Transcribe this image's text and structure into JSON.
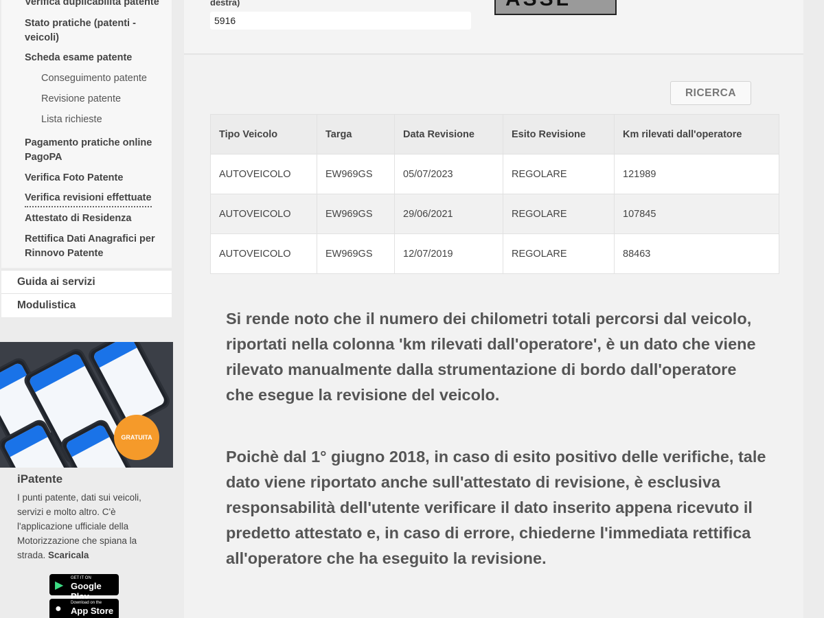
{
  "sidebar": {
    "menu_items": [
      {
        "label": "Verifica duplicabilità  patente"
      },
      {
        "label": "Stato pratiche (patenti - veicoli)"
      },
      {
        "label": "Scheda esame patente"
      },
      {
        "label": "Pagamento pratiche online PagoPA"
      },
      {
        "label": "Verifica Foto Patente"
      },
      {
        "label": "Verifica revisioni effettuate"
      },
      {
        "label": "Attestato di Residenza"
      },
      {
        "label": "Rettifica Dati Anagrafici per Rinnovo Patente"
      }
    ],
    "sub_items": [
      {
        "label": "Conseguimento patente"
      },
      {
        "label": "Revisione patente"
      },
      {
        "label": "Lista richieste"
      }
    ],
    "top_items": [
      {
        "label": "Guida ai servizi"
      },
      {
        "label": "Modulistica"
      }
    ],
    "promo": {
      "badge": "GRATUITA",
      "title": "iPatente",
      "description": "I punti patente, dati sui veicoli, servizi e molto altro. C'è l'applicazione ufficiale della Motorizzazione che spiana la strada.",
      "cta": "Scaricala",
      "google_play_small": "GET IT ON",
      "google_play_big": "Google Play",
      "app_store_small": "Download on the",
      "app_store_big": "App Store"
    }
  },
  "form": {
    "field_label_tail": "destra)",
    "field_value": "5916",
    "captcha_text": "ASSL"
  },
  "search_button": "RICERCA",
  "table": {
    "headers": [
      "Tipo Veicolo",
      "Targa",
      "Data Revisione",
      "Esito Revisione",
      "Km rilevati dall'operatore"
    ],
    "rows": [
      [
        "AUTOVEICOLO",
        "EW969GS",
        "05/07/2023",
        "REGOLARE",
        "121989"
      ],
      [
        "AUTOVEICOLO",
        "EW969GS",
        "29/06/2021",
        "REGOLARE",
        "107845"
      ],
      [
        "AUTOVEICOLO",
        "EW969GS",
        "12/07/2019",
        "REGOLARE",
        "88463"
      ]
    ]
  },
  "notices": [
    "Si rende noto che il numero dei chilometri totali percorsi dal veicolo, riportati nella colonna 'km rilevati dall'operatore', è un dato che viene rilevato manualmente dalla strumentazione di bordo dall'operatore che esegue la revisione del veicolo.",
    "Poichè dal 1° giugno 2018, in caso di esito positivo delle verifiche, tale dato viene riportato anche sull'attestato di revisione, è esclusiva responsabilità dell'utente verificare il dato inserito appena ricevuto il predetto attestato e, in caso di errore, chiederne l'immediata rettifica all'operatore che ha eseguito la revisione."
  ]
}
